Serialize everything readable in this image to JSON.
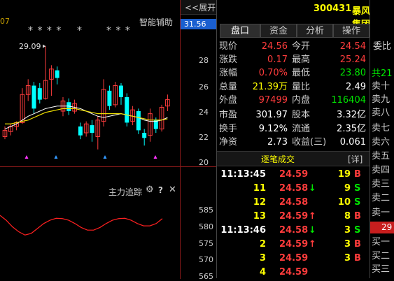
{
  "header": {
    "expand_label": "<<展开",
    "stock_code": "300431",
    "stock_name": "暴风集团",
    "current_price_tag": "31.56"
  },
  "kline": {
    "left_edge_text": "07",
    "indicator_label": "智能辅助",
    "star_marks": [
      "* * * *",
      "*",
      "* * *"
    ],
    "high_annotation": "29.09",
    "y_ticks": [
      "28",
      "26",
      "24",
      "22",
      "20"
    ],
    "candles": [
      {
        "o": 22.0,
        "c": 22.5,
        "h": 22.8,
        "l": 21.8
      },
      {
        "o": 22.4,
        "c": 22.8,
        "h": 23.0,
        "l": 22.1
      },
      {
        "o": 22.8,
        "c": 23.1,
        "h": 23.2,
        "l": 22.5
      },
      {
        "o": 23.1,
        "c": 25.3,
        "h": 25.8,
        "l": 23.0
      },
      {
        "o": 25.3,
        "c": 26.0,
        "h": 26.5,
        "l": 24.8
      },
      {
        "o": 26.0,
        "c": 24.2,
        "h": 26.3,
        "l": 23.8
      },
      {
        "o": 25.8,
        "c": 24.9,
        "h": 26.2,
        "l": 24.6
      },
      {
        "o": 25.0,
        "c": 26.4,
        "h": 29.09,
        "l": 24.9
      },
      {
        "o": 26.5,
        "c": 27.3,
        "h": 27.6,
        "l": 25.2
      },
      {
        "o": 27.2,
        "c": 26.6,
        "h": 27.5,
        "l": 26.1
      },
      {
        "o": 24.0,
        "c": 24.8,
        "h": 25.1,
        "l": 23.6
      },
      {
        "o": 24.7,
        "c": 24.0,
        "h": 25.0,
        "l": 23.7
      },
      {
        "o": 24.0,
        "c": 24.6,
        "h": 24.9,
        "l": 23.8
      },
      {
        "o": 22.8,
        "c": 22.1,
        "h": 23.1,
        "l": 21.8
      },
      {
        "o": 22.3,
        "c": 23.0,
        "h": 23.2,
        "l": 22.0
      },
      {
        "o": 22.9,
        "c": 22.3,
        "h": 23.3,
        "l": 21.6
      },
      {
        "o": 22.0,
        "c": 23.3,
        "h": 23.6,
        "l": 21.0
      },
      {
        "o": 23.2,
        "c": 25.7,
        "h": 26.5,
        "l": 22.8
      },
      {
        "o": 25.6,
        "c": 24.4,
        "h": 26.0,
        "l": 24.1
      },
      {
        "o": 24.5,
        "c": 26.0,
        "h": 26.3,
        "l": 24.3
      },
      {
        "o": 26.0,
        "c": 25.1,
        "h": 26.2,
        "l": 24.5
      },
      {
        "o": 25.1,
        "c": 23.1,
        "h": 25.4,
        "l": 22.8
      },
      {
        "o": 23.2,
        "c": 24.1,
        "h": 24.4,
        "l": 22.9
      },
      {
        "o": 24.0,
        "c": 22.5,
        "h": 24.2,
        "l": 22.2
      },
      {
        "o": 22.3,
        "c": 21.9,
        "h": 22.6,
        "l": 21.3
      },
      {
        "o": 22.1,
        "c": 23.8,
        "h": 24.2,
        "l": 21.6
      },
      {
        "o": 23.3,
        "c": 22.6,
        "h": 23.5,
        "l": 22.3
      },
      {
        "o": 22.6,
        "c": 24.3,
        "h": 24.5,
        "l": 22.4
      },
      {
        "o": 24.4,
        "c": 24.9,
        "h": 25.3,
        "l": 24.0
      }
    ],
    "ma_white": [
      22.6,
      22.8,
      23.0,
      23.3,
      23.6,
      23.8,
      24.0,
      24.2,
      24.3,
      24.4,
      24.4,
      24.4,
      24.3,
      24.2,
      24.0,
      23.8,
      23.6,
      23.5,
      23.6,
      23.7,
      23.8,
      23.7,
      23.6,
      23.5,
      23.3,
      23.2,
      23.2,
      23.3,
      23.5
    ],
    "ma_yellow": [
      23.0,
      23.0,
      23.1,
      23.2,
      23.3,
      23.5,
      23.7,
      23.9,
      24.0,
      24.1,
      24.2,
      24.2,
      24.2,
      24.1,
      24.0,
      23.9,
      23.8,
      23.8,
      23.8,
      23.8,
      23.8,
      23.7,
      23.6,
      23.5,
      23.4,
      23.3,
      23.3,
      23.3,
      23.4
    ]
  },
  "sub_chart": {
    "title": "主力追踪",
    "y_ticks": [
      "585",
      "580",
      "575",
      "570",
      "565"
    ],
    "values": [
      583.5,
      582.0,
      580.0,
      578.5,
      577.5,
      578.0,
      579.5,
      581.0,
      582.0,
      582.6,
      582.5,
      582.0,
      581.0,
      579.8,
      579.0,
      579.0,
      579.8,
      581.0,
      582.0,
      582.5,
      582.6,
      582.0,
      581.0,
      580.3,
      580.3,
      581.0,
      582.5
    ]
  },
  "tabs": [
    {
      "label": "盘口"
    },
    {
      "label": "资金"
    },
    {
      "label": "分析"
    },
    {
      "label": "操作"
    }
  ],
  "quote": {
    "rows": [
      {
        "l1": "现价",
        "v1": "24.56",
        "c1": "#ff3c3c",
        "l2": "今开",
        "v2": "24.54",
        "c2": "#ff3c3c"
      },
      {
        "l1": "涨跌",
        "v1": "0.17",
        "c1": "#ff3c3c",
        "l2": "最高",
        "v2": "25.24",
        "c2": "#ff3c3c"
      },
      {
        "l1": "涨幅",
        "v1": "0.70%",
        "c1": "#ff3c3c",
        "l2": "最低",
        "v2": "23.80",
        "c2": "#00e600"
      },
      {
        "l1": "总量",
        "v1": "21.39万",
        "c1": "#ffff00",
        "l2": "量比",
        "v2": "2.49",
        "c2": "#ffffff"
      },
      {
        "l1": "外盘",
        "v1": "97499",
        "c1": "#ff3c3c",
        "l2": "内盘",
        "v2": "116404",
        "c2": "#00e600"
      },
      {
        "l1": "市盈",
        "v1": "301.97",
        "c1": "#ffffff",
        "l2": "股本",
        "v2": "3.32亿",
        "c2": "#ffffff"
      },
      {
        "l1": "换手",
        "v1": "9.12%",
        "c1": "#ffffff",
        "l2": "流通",
        "v2": "2.35亿",
        "c2": "#ffffff"
      },
      {
        "l1": "净资",
        "v1": "2.73",
        "c1": "#ffffff",
        "l2": "收益(三)",
        "v2": "0.061",
        "c2": "#ffffff"
      }
    ]
  },
  "trades": {
    "title": "逐笔成交",
    "detail_label": "[详]",
    "rows": [
      {
        "time": "11:13:45",
        "price": "24.59",
        "arrow": "",
        "vol": "19",
        "side": "B"
      },
      {
        "time": "11",
        "price": "24.58",
        "arrow": "↓",
        "vol": "9",
        "side": "S"
      },
      {
        "time": "12",
        "price": "24.58",
        "arrow": "",
        "vol": "10",
        "side": "S"
      },
      {
        "time": "13",
        "price": "24.59",
        "arrow": "↑",
        "vol": "8",
        "side": "B"
      },
      {
        "time": "11:13:46",
        "price": "24.58",
        "arrow": "↓",
        "vol": "3",
        "side": "S"
      },
      {
        "time": "2",
        "price": "24.59",
        "arrow": "↑",
        "vol": "3",
        "side": "B"
      },
      {
        "time": "3",
        "price": "24.59",
        "arrow": "",
        "vol": "3",
        "side": "B"
      },
      {
        "time": "4",
        "price": "24.59",
        "arrow": "",
        "vol": "",
        "side": ""
      }
    ]
  },
  "order_book": {
    "header": "委比",
    "ratio_partial": "共21",
    "asks": [
      "卖十",
      "卖九",
      "卖八",
      "卖七",
      "卖六",
      "卖五",
      "卖四",
      "卖三",
      "卖二",
      "卖一"
    ],
    "price_badge": "29",
    "bids": [
      "买一",
      "买二",
      "买三"
    ]
  },
  "colors": {
    "up": "#ff3c3c",
    "down": "#00ffff",
    "green": "#00e600",
    "ma_white": "#ffffff",
    "ma_yellow": "#f0e000",
    "grid": "#8b1a1a"
  }
}
